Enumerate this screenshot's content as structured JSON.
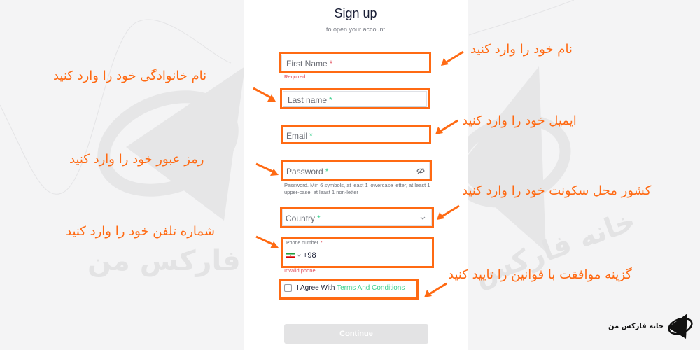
{
  "form": {
    "title": "Sign up",
    "subtitle": "to open your account",
    "first_name": {
      "placeholder": "First Name",
      "required_mark": "*",
      "error": "Required"
    },
    "last_name": {
      "placeholder": "Last name",
      "required_mark": "*"
    },
    "email": {
      "placeholder": "Email",
      "required_mark": "*"
    },
    "password": {
      "placeholder": "Password",
      "required_mark": "*",
      "hint": "Password. Min 6 symbols, at least 1 lowercase letter, at least 1 upper-case, at least 1 non-letter"
    },
    "country": {
      "placeholder": "Country",
      "required_mark": "*"
    },
    "phone": {
      "label": "Phone number",
      "required_mark": "*",
      "country_code": "+98",
      "error": "Invalid phone"
    },
    "terms": {
      "prefix": "I Agree With",
      "link": "Terms And Conditions",
      "checked": false
    },
    "continue_label": "Continue"
  },
  "annotations": {
    "first_name": "نام خود را وارد کنید",
    "last_name": "نام خانوادگی خود را وارد کنید",
    "email": "ایمیل خود را وارد کنید",
    "password": "رمز عبور خود را وارد کنید",
    "country": "کشور محل سکونت خود را وارد کنید",
    "phone": "شماره تلفن خود را وارد کنید",
    "terms": "گزینه موافقت با قوانین را تایید کنید"
  },
  "brand": {
    "name": "خانه فارکس من",
    "watermark": "خانه فارکس من"
  },
  "colors": {
    "highlight": "#ff6a13",
    "error": "#e24d5b",
    "required_green": "#3bd18f",
    "link": "#3bd18f"
  }
}
